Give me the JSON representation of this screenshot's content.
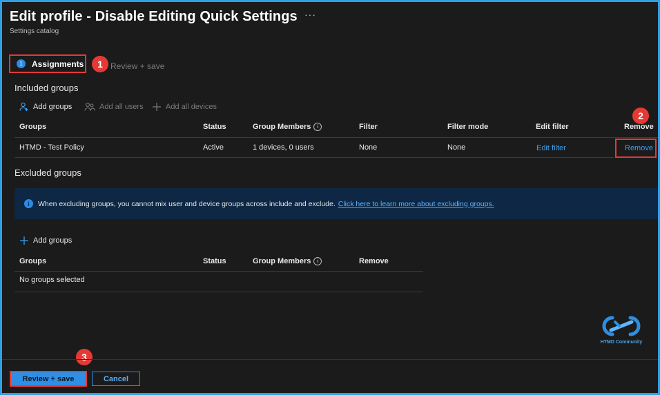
{
  "header": {
    "title": "Edit profile - Disable Editing Quick Settings",
    "more": "···",
    "subtitle": "Settings catalog"
  },
  "tabs": [
    {
      "step": "1",
      "label": "Assignments"
    },
    {
      "label": "Review + save"
    }
  ],
  "annotations": [
    "1",
    "2",
    "3"
  ],
  "included": {
    "heading": "Included groups",
    "commands": [
      "Add groups",
      "Add all users",
      "Add all devices"
    ],
    "columns": [
      "Groups",
      "Status",
      "Group Members",
      "Filter",
      "Filter mode",
      "Edit filter",
      "Remove"
    ],
    "rows": [
      {
        "group": "HTMD - Test Policy",
        "status": "Active",
        "members": "1 devices, 0 users",
        "filter": "None",
        "filter_mode": "None",
        "edit_filter": "Edit filter",
        "remove": "Remove"
      }
    ]
  },
  "excluded": {
    "heading": "Excluded groups",
    "banner_text": "When excluding groups, you cannot mix user and device groups across include and exclude.",
    "banner_link": "Click here to learn more about excluding groups.",
    "command": "Add groups",
    "columns": [
      "Groups",
      "Status",
      "Group Members",
      "Remove"
    ],
    "empty": "No groups selected"
  },
  "footer": {
    "primary": "Review + save",
    "secondary": "Cancel"
  },
  "logo_text": "HTMD Community",
  "colors": {
    "accent": "#2f8fe5",
    "annotation": "#e53935",
    "background": "#1b1b1b",
    "banner": "#0d2744"
  }
}
